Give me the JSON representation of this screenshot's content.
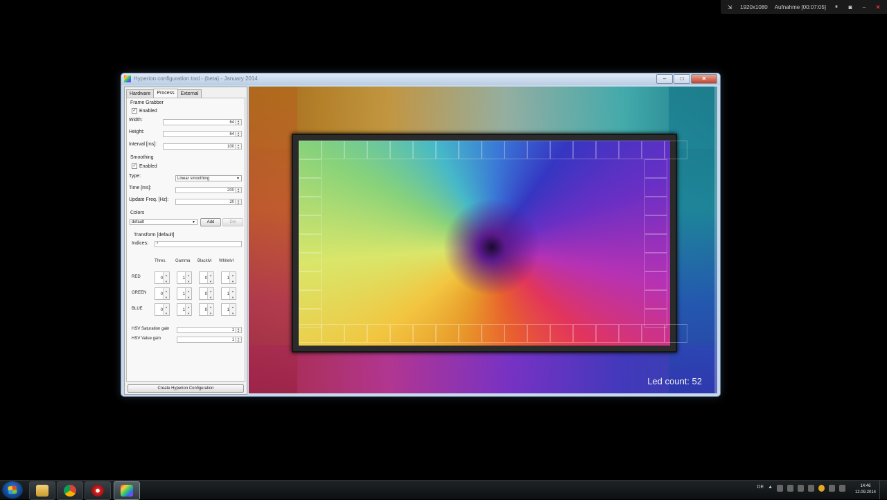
{
  "recorder": {
    "resolution": "1920x1080",
    "recording": "Aufnahme [00:07:05]"
  },
  "window": {
    "title": "Hyperion configuration tool - (beta) - January 2014"
  },
  "tabs": [
    "Hardware",
    "Process",
    "External"
  ],
  "active_tab": "Process",
  "frame_grabber": {
    "label": "Frame Grabber",
    "enabled_label": "Enabled",
    "enabled": true,
    "width_label": "Width:",
    "width": "64",
    "height_label": "Height:",
    "height": "64",
    "interval_label": "Interval [ms]:",
    "interval": "100"
  },
  "smoothing": {
    "label": "Smoothing",
    "enabled_label": "Enabled",
    "enabled": true,
    "type_label": "Type:",
    "type": "Linear smoothing",
    "time_label": "Time [ms]:",
    "time": "200",
    "update_label": "Update Freq. [Hz]:",
    "update": "20"
  },
  "colors": {
    "label": "Colors",
    "selected": "default",
    "add_label": "Add",
    "del_label": "Del",
    "transform_label": "Transform [default]",
    "indices_label": "Indices:",
    "indices_value": "*",
    "columns": [
      "Thres.",
      "Gamma",
      "Blacklvl",
      "Whitelvl"
    ],
    "rows": [
      {
        "label": "RED",
        "values": [
          "0",
          "1",
          "0",
          "1"
        ]
      },
      {
        "label": "GREEN",
        "values": [
          "0",
          "1",
          "0",
          "1"
        ]
      },
      {
        "label": "BLUE",
        "values": [
          "0",
          "1",
          "0",
          "1"
        ]
      }
    ],
    "hsv_sat_label": "HSV Saturation gain",
    "hsv_sat": "1",
    "hsv_val_label": "HSV Value gain",
    "hsv_val": "1"
  },
  "create_button": "Create Hyperion Configuration",
  "preview": {
    "led_count_text": "Led count: 52"
  },
  "tray": {
    "lang": "DE",
    "time": "14:46",
    "date": "12.09.2014"
  },
  "icons": [
    "windows-start-icon",
    "explorer-icon",
    "chrome-icon",
    "media-icon",
    "hyperion-icon"
  ]
}
